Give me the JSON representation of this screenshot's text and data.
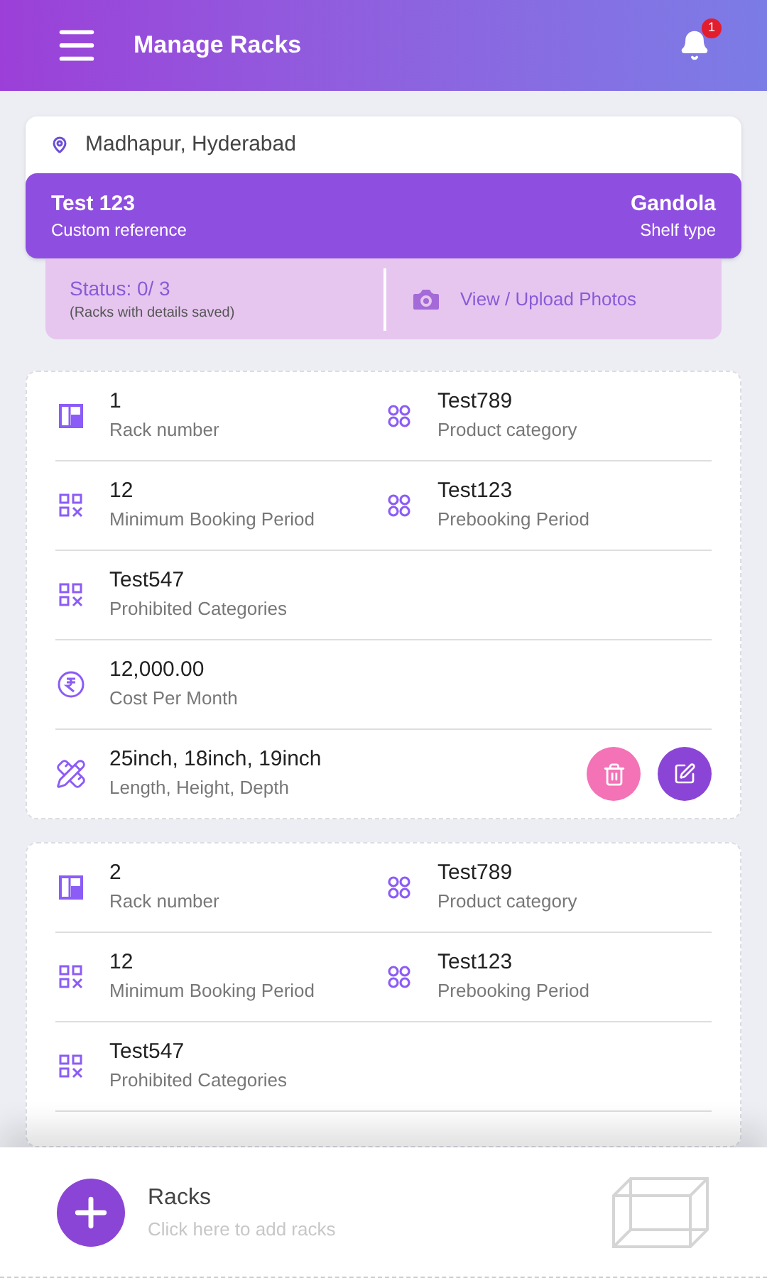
{
  "header": {
    "title": "Manage Racks",
    "notification_count": "1"
  },
  "store": {
    "location": "Madhapur, Hyderabad",
    "reference": "Test 123",
    "reference_label": "Custom reference",
    "shelf": "Gandola",
    "shelf_label": "Shelf type"
  },
  "status": {
    "title": "Status: 0/ 3",
    "subtitle": "(Racks with details saved)",
    "photos_link": "View / Upload Photos"
  },
  "racks": [
    {
      "rows": [
        {
          "cells": [
            {
              "kind": "rack",
              "value": "1",
              "label": "Rack number"
            },
            {
              "kind": "category",
              "value": "Test789",
              "label": "Product category"
            }
          ]
        },
        {
          "cells": [
            {
              "kind": "booking",
              "value": "12",
              "label": "Minimum Booking Period"
            },
            {
              "kind": "category",
              "value": "Test123",
              "label": "Prebooking Period"
            }
          ]
        },
        {
          "cells": [
            {
              "kind": "booking",
              "value": "Test547",
              "label": "Prohibited Categories"
            }
          ]
        },
        {
          "cells": [
            {
              "kind": "cost",
              "value": "12,000.00",
              "label": "Cost Per Month"
            }
          ]
        },
        {
          "cells": [
            {
              "kind": "dimensions",
              "value": "25inch, 18inch, 19inch",
              "label": "Length, Height, Depth"
            }
          ],
          "actions": [
            {
              "kind": "delete"
            },
            {
              "kind": "edit"
            }
          ]
        }
      ]
    },
    {
      "rows": [
        {
          "cells": [
            {
              "kind": "rack",
              "value": "2",
              "label": "Rack number"
            },
            {
              "kind": "category",
              "value": "Test789",
              "label": "Product category"
            }
          ]
        },
        {
          "cells": [
            {
              "kind": "booking",
              "value": "12",
              "label": "Minimum Booking Period"
            },
            {
              "kind": "category",
              "value": "Test123",
              "label": "Prebooking Period"
            }
          ]
        },
        {
          "cells": [
            {
              "kind": "booking",
              "value": "Test547",
              "label": "Prohibited Categories"
            }
          ]
        }
      ]
    }
  ],
  "footer": {
    "title": "Racks",
    "subtitle": "Click here to add racks"
  }
}
